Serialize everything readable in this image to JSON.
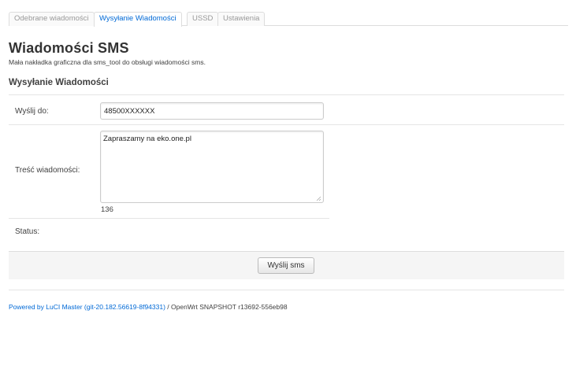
{
  "tabs": [
    {
      "label": "Odebrane wiadomości",
      "active": false
    },
    {
      "label": "Wysyłanie Wiadomości",
      "active": true
    },
    {
      "label": "USSD",
      "active": false
    },
    {
      "label": "Ustawienia",
      "active": false
    }
  ],
  "header": {
    "title": "Wiadomości SMS",
    "description": "Mała nakładka graficzna dla sms_tool do obsługi wiadomości sms."
  },
  "section": {
    "title": "Wysyłanie Wiadomości"
  },
  "form": {
    "recipient_label": "Wyślij do:",
    "recipient_value": "48500XXXXXX",
    "message_label": "Treść wiadomości:",
    "message_value": "Zapraszamy na eko.one.pl",
    "char_count": "136",
    "status_label": "Status:",
    "status_value": ""
  },
  "actions": {
    "send_label": "Wyślij sms"
  },
  "footer": {
    "link_text": "Powered by LuCI Master (git-20.182.56619-8f94331)",
    "version_text": " / OpenWrt SNAPSHOT r13692-556eb98"
  },
  "colors": {
    "accent": "#0069d6",
    "bar_background": "#f5f5f5"
  }
}
